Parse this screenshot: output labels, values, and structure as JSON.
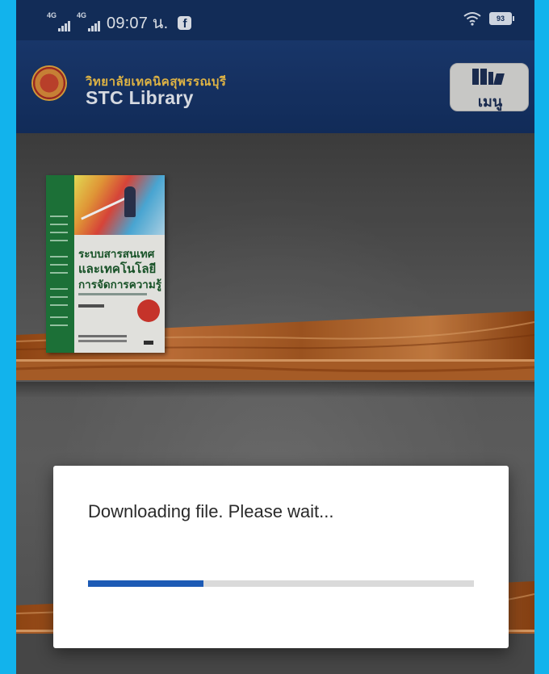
{
  "status_bar": {
    "network1": "4G",
    "network2": "4G",
    "time": "09:07 น.",
    "notification_icon": "facebook-icon",
    "wifi_icon": "wifi-icon",
    "battery": "93"
  },
  "app_bar": {
    "subtitle": "วิทยาลัยเทคนิคสุพรรณบุรี",
    "title": "STC Library",
    "menu_label": "เมนู"
  },
  "book": {
    "title_line1": "ระบบสารสนเทศ",
    "title_line2": "และเทคโนโลยี",
    "title_line3": "การจัดการความรู้"
  },
  "dialog": {
    "message": "Downloading file. Please wait...",
    "progress": 0.3
  },
  "colors": {
    "outer_background": "#12b3ec",
    "header": "#14305f",
    "progress_fill": "#1d5bb5"
  }
}
